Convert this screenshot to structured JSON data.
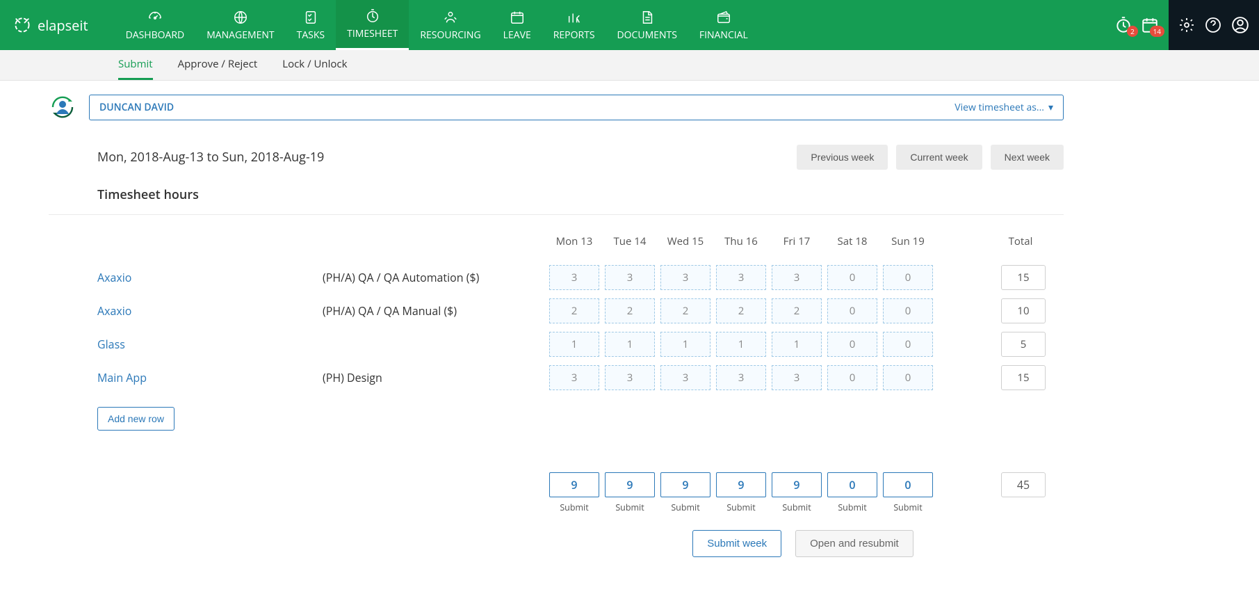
{
  "brand": "elapseit",
  "nav": [
    {
      "label": "DASHBOARD"
    },
    {
      "label": "MANAGEMENT"
    },
    {
      "label": "TASKS"
    },
    {
      "label": "TIMESHEET"
    },
    {
      "label": "RESOURCING"
    },
    {
      "label": "LEAVE"
    },
    {
      "label": "REPORTS"
    },
    {
      "label": "DOCUMENTS"
    },
    {
      "label": "FINANCIAL"
    }
  ],
  "notifications": {
    "timer_badge": "2",
    "calendar_badge": "14"
  },
  "subnav": {
    "submit": "Submit",
    "approve": "Approve / Reject",
    "lock": "Lock / Unlock"
  },
  "user": {
    "name": "DUNCAN DAVID",
    "view_as": "View timesheet as..."
  },
  "date_range": "Mon, 2018-Aug-13 to Sun, 2018-Aug-19",
  "week_nav": {
    "prev": "Previous week",
    "current": "Current week",
    "next": "Next week"
  },
  "section_title": "Timesheet hours",
  "day_headers": [
    "Mon 13",
    "Tue 14",
    "Wed 15",
    "Thu 16",
    "Fri 17",
    "Sat 18",
    "Sun 19"
  ],
  "total_label": "Total",
  "rows": [
    {
      "project": "Axaxio",
      "task": "(PH/A) QA / QA Automation ($)",
      "cells": [
        "3",
        "3",
        "3",
        "3",
        "3",
        "0",
        "0"
      ],
      "total": "15"
    },
    {
      "project": "Axaxio",
      "task": "(PH/A) QA / QA Manual ($)",
      "cells": [
        "2",
        "2",
        "2",
        "2",
        "2",
        "0",
        "0"
      ],
      "total": "10"
    },
    {
      "project": "Glass",
      "task": "",
      "cells": [
        "1",
        "1",
        "1",
        "1",
        "1",
        "0",
        "0"
      ],
      "total": "5"
    },
    {
      "project": "Main App",
      "task": "(PH) Design",
      "cells": [
        "3",
        "3",
        "3",
        "3",
        "3",
        "0",
        "0"
      ],
      "total": "15"
    }
  ],
  "add_row": "Add new row",
  "daily_totals": [
    "9",
    "9",
    "9",
    "9",
    "9",
    "0",
    "0"
  ],
  "daily_submit_label": "Submit",
  "grand_total": "45",
  "actions": {
    "submit_week": "Submit week",
    "open_resubmit": "Open and resubmit"
  }
}
